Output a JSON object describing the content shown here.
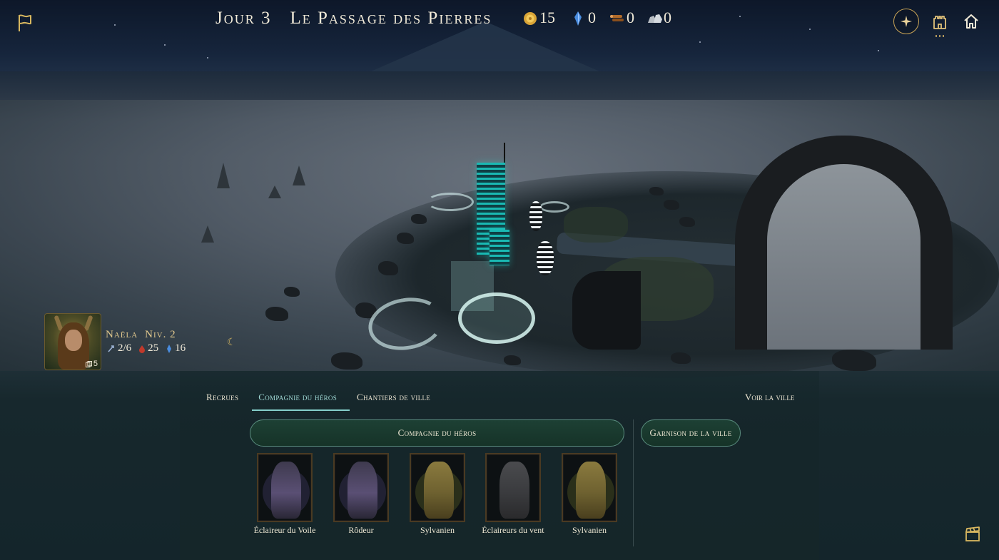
{
  "header": {
    "day": "Jour 3",
    "map_name": "Le Passage des Pierres",
    "resources": [
      {
        "icon": "gold-coin-icon",
        "value": "15"
      },
      {
        "icon": "blue-crystal-icon",
        "value": "0"
      },
      {
        "icon": "wood-logs-icon",
        "value": "0"
      },
      {
        "icon": "stone-ore-icon",
        "value": "0"
      }
    ]
  },
  "top_controls": {
    "left": "flag-icon",
    "right": [
      "compass-star-icon",
      "castle-icon",
      "home-icon"
    ]
  },
  "hero": {
    "name": "Naëla",
    "level": "Niv. 2",
    "army_count": "5",
    "stats": [
      {
        "icon": "movement-icon",
        "value": "2/6"
      },
      {
        "icon": "health-icon",
        "value": "25"
      },
      {
        "icon": "mana-icon",
        "value": "16"
      }
    ]
  },
  "tabs": [
    {
      "label": "Recrues",
      "active": false
    },
    {
      "label": "Compagnie du héros",
      "active": true
    },
    {
      "label": "Chantiers de ville",
      "active": false
    }
  ],
  "voir_la_ville": "Voir la ville",
  "groups": {
    "hero_company": "Compagnie du héros",
    "garrison": "Garnison de la ville"
  },
  "units": [
    {
      "name": "Éclaireur du Voile",
      "style": "dark"
    },
    {
      "name": "Rôdeur",
      "style": "dark"
    },
    {
      "name": "Sylvanien",
      "style": "tree"
    },
    {
      "name": "Éclaireurs du vent",
      "style": "grey"
    },
    {
      "name": "Sylvanien",
      "style": "tree"
    }
  ],
  "colors": {
    "accent_gold": "#d9b860",
    "tab_active": "#86cfcb",
    "pill_green": "#1d4034"
  }
}
